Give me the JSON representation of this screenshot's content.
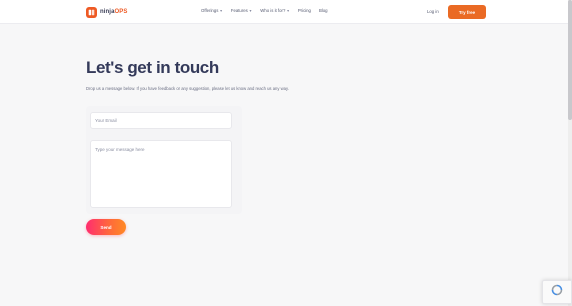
{
  "brand": {
    "name_prefix": "ninja",
    "name_suffix": "OPS",
    "accent_color": "#ee5a24"
  },
  "nav": {
    "items": [
      {
        "label": "Offerings",
        "has_dropdown": true
      },
      {
        "label": "Features",
        "has_dropdown": true
      },
      {
        "label": "Who is it for?",
        "has_dropdown": true
      },
      {
        "label": "Pricing",
        "has_dropdown": false
      },
      {
        "label": "Blog",
        "has_dropdown": false
      }
    ],
    "login_label": "Log in",
    "cta_label": "Try free",
    "cta_color": "#ea6a24"
  },
  "contact": {
    "heading": "Let's get in touch",
    "intro": "Drop us a message below. If you have feedback or any suggestion, please let us know and reach us any way.",
    "email_placeholder": "Your Email",
    "message_placeholder": "Type your message here",
    "send_label": "Send"
  },
  "icons": {
    "logo": "logo-mark-icon",
    "dropdown": "chevron-down-icon",
    "captcha": "recaptcha-icon"
  }
}
